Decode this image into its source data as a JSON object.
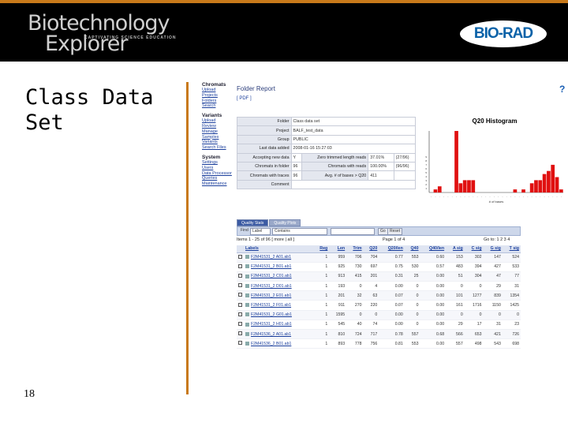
{
  "banner": {
    "logo_title": "Biotechnology",
    "logo_subtitle": "Explorer",
    "logo_tagline": "CAPTIVATING     SCIENCE EDUCATION",
    "brand": "BIO-RAD",
    "accent_color": "#c8791a"
  },
  "slide": {
    "title_line1": "Class Data",
    "title_line2": "Set",
    "number": "18"
  },
  "nav": {
    "sections": [
      {
        "heading": "Chromats",
        "links": [
          "Upload",
          "Projects",
          "Folders",
          "Search"
        ]
      },
      {
        "heading": "Variants",
        "links": [
          "Upload",
          "Review",
          "Manage",
          "Samples",
          "Variants",
          "Search Files"
        ]
      },
      {
        "heading": "System",
        "links": [
          "Settings",
          "Users",
          "Data Processor",
          "Queries",
          "Maintenance"
        ]
      }
    ]
  },
  "report": {
    "title": "Folder Report",
    "pdf_link": "[ PDF ]",
    "rows": [
      {
        "k1": "Folder",
        "v1": "Class data set"
      },
      {
        "k1": "Project",
        "v1": "BALF_test_data"
      },
      {
        "k1": "Group",
        "v1": "PUBLIC"
      },
      {
        "k1": "Last data added",
        "v1": "2008-01-16 15:27:03"
      },
      {
        "k1": "Accepting new data",
        "v1": "Y",
        "k2": "Zero trimmed length reads",
        "v2": "37.01%",
        "v3": "(27/96)"
      },
      {
        "k1": "Chromats in folder",
        "v1": "96",
        "k2": "Chromats with reads",
        "v2": "100.00%",
        "v3": "(96/96)"
      },
      {
        "k1": "Chromats with traces",
        "v1": "96",
        "k2": "Avg. # of bases > Q20",
        "v2": "411"
      },
      {
        "k1": "Comment",
        "v1": ""
      }
    ]
  },
  "chart_data": {
    "type": "bar",
    "title": "Q20 Histogram",
    "xlabel": "# of bases",
    "values": [
      0,
      1,
      2,
      0,
      0,
      0,
      20,
      3,
      4,
      4,
      4,
      0,
      0,
      0,
      0,
      0,
      0,
      0,
      0,
      0,
      1,
      0,
      1,
      0,
      3,
      4,
      4,
      6,
      7,
      9,
      5,
      1
    ],
    "y_ticks": [
      "1",
      "2",
      "3",
      "4",
      "5",
      "6",
      "7",
      "8",
      "9"
    ],
    "ylim": [
      0,
      20
    ],
    "grid": false,
    "bar_color": "#e01010"
  },
  "grid": {
    "tabs": [
      "Quality Stats",
      "Quality Plots"
    ],
    "toolbar": {
      "find_label": "Find",
      "field_select": "Label",
      "mode_select": "Contains",
      "go": "Go",
      "reset": "Reset"
    },
    "pager_left": "Items 1 - 25 of 96  [ more | all ]",
    "pager_mid": "Page 1 of 4",
    "pager_right": "Go to: 1  2  3  4",
    "columns": [
      "Labels",
      "Reg",
      "Len",
      "Trim",
      "Q20",
      "Q20/len",
      "Q40",
      "Q40/len",
      "A sig",
      "C sig",
      "G sig",
      "T sig"
    ],
    "rows": [
      [
        "F2M41531_2 A01.ab1",
        "1",
        "959",
        "706",
        "704",
        "0.77",
        "553",
        "0.60",
        "153",
        "302",
        "147",
        "524"
      ],
      [
        "F2M41531_2 B01.ab1",
        "1",
        "925",
        "730",
        "697",
        "0.75",
        "530",
        "0.57",
        "483",
        "394",
        "427",
        "533"
      ],
      [
        "F2M41531_2 C01.ab1",
        "1",
        "913",
        "415",
        "201",
        "0.31",
        "25",
        "0.00",
        "51",
        "304",
        "47",
        "77"
      ],
      [
        "F2M41531_2 D01.ab1",
        "1",
        "193",
        "0",
        "4",
        "0.00",
        "0",
        "0.00",
        "0",
        "0",
        "29",
        "31"
      ],
      [
        "F2M41531_2 E01.ab1",
        "1",
        "201",
        "32",
        "63",
        "0.07",
        "0",
        "0.00",
        "101",
        "1277",
        "839",
        "1354"
      ],
      [
        "F2M41531_2 F01.ab1",
        "1",
        "911",
        "270",
        "220",
        "0.07",
        "0",
        "0.00",
        "161",
        "1716",
        "1150",
        "1425"
      ],
      [
        "F2M41531_2 G01.ab1",
        "1",
        "1595",
        "0",
        "0",
        "0.00",
        "0",
        "0.00",
        "0",
        "0",
        "0",
        "0"
      ],
      [
        "F2M41531_2 H01.ab1",
        "1",
        "545",
        "40",
        "74",
        "0.00",
        "0",
        "0.00",
        "29",
        "17",
        "31",
        "23"
      ],
      [
        "F2M41536_2 A01.ab1",
        "1",
        "810",
        "724",
        "717",
        "0.78",
        "557",
        "0.68",
        "566",
        "653",
        "421",
        "726"
      ],
      [
        "F2M41536_2 B01.ab1",
        "1",
        "893",
        "778",
        "756",
        "0.81",
        "553",
        "0.00",
        "557",
        "498",
        "543",
        "698"
      ]
    ]
  }
}
